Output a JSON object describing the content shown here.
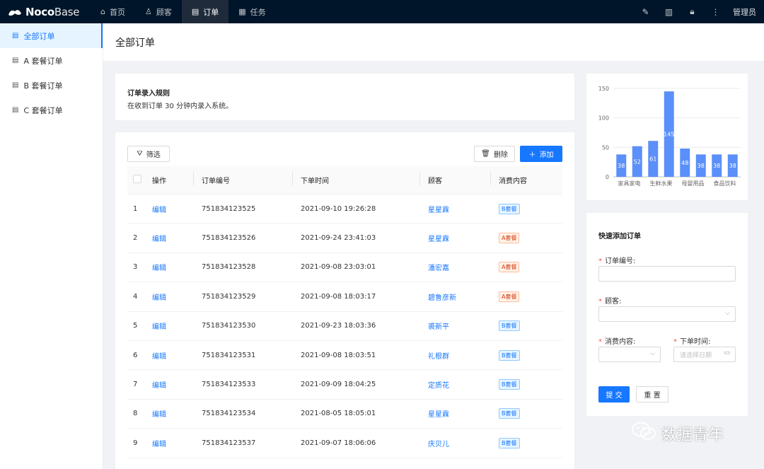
{
  "app": {
    "logo_bold": "Noco",
    "logo_thin": "Base"
  },
  "nav": {
    "items": [
      {
        "label": "首页",
        "icon": "home-icon"
      },
      {
        "label": "顾客",
        "icon": "users-icon"
      },
      {
        "label": "订单",
        "icon": "file-icon"
      },
      {
        "label": "任务",
        "icon": "task-icon"
      }
    ],
    "active": "订单",
    "user": "管理员"
  },
  "sidebar": {
    "items": [
      {
        "label": "全部订单"
      },
      {
        "label": "A 套餐订单"
      },
      {
        "label": "B 套餐订单"
      },
      {
        "label": "C 套餐订单"
      }
    ]
  },
  "page": {
    "title": "全部订单"
  },
  "rule": {
    "title": "订单录入规则",
    "text": "在收到订单 30 分钟内录入系统。"
  },
  "toolbar": {
    "filter_label": "筛选",
    "delete_label": "删除",
    "add_label": "添加"
  },
  "table": {
    "columns": [
      "操作",
      "订单编号",
      "下单时间",
      "顾客",
      "消费内容"
    ],
    "rows": [
      {
        "no": "1",
        "action": "编辑",
        "order_id": "751834123525",
        "time": "2021-09-10 19:26:28",
        "customer": "星星霖",
        "tag": "B套餐"
      },
      {
        "no": "2",
        "action": "编辑",
        "order_id": "751834123526",
        "time": "2021-09-24 23:41:03",
        "customer": "星星霖",
        "tag": "A套餐"
      },
      {
        "no": "3",
        "action": "编辑",
        "order_id": "751834123528",
        "time": "2021-09-08 23:03:01",
        "customer": "潘宏嘉",
        "tag": "A套餐"
      },
      {
        "no": "4",
        "action": "编辑",
        "order_id": "751834123529",
        "time": "2021-09-08 18:03:17",
        "customer": "碧鲁彦新",
        "tag": "A套餐"
      },
      {
        "no": "5",
        "action": "编辑",
        "order_id": "751834123530",
        "time": "2021-09-23 18:03:36",
        "customer": "裘新平",
        "tag": "B套餐"
      },
      {
        "no": "6",
        "action": "编辑",
        "order_id": "751834123531",
        "time": "2021-09-08 18:03:51",
        "customer": "礼根群",
        "tag": "B套餐"
      },
      {
        "no": "7",
        "action": "编辑",
        "order_id": "751834123533",
        "time": "2021-09-09 18:04:25",
        "customer": "定质花",
        "tag": "B套餐"
      },
      {
        "no": "8",
        "action": "编辑",
        "order_id": "751834123534",
        "time": "2021-08-05 18:05:01",
        "customer": "星星霖",
        "tag": "B套餐"
      },
      {
        "no": "9",
        "action": "编辑",
        "order_id": "751834123537",
        "time": "2021-09-07 18:06:06",
        "customer": "庆贝儿",
        "tag": "B套餐"
      }
    ]
  },
  "chart_data": {
    "type": "bar",
    "categories": [
      "家具家电",
      "",
      "生鲜水果",
      "",
      "母婴用品",
      "",
      "食品饮料",
      ""
    ],
    "values": [
      38,
      52,
      61,
      145,
      48,
      38,
      38,
      38
    ],
    "ylim": [
      0,
      150
    ],
    "yticks": [
      0,
      50,
      100,
      150
    ],
    "grid": true,
    "color": "#5b8ff9"
  },
  "form": {
    "title": "快速添加订单",
    "order_id_label": "订单编号:",
    "customer_label": "顾客:",
    "content_label": "消费内容:",
    "time_label": "下单时间:",
    "date_placeholder": "请选择日期",
    "submit_label": "提 交",
    "reset_label": "重 置"
  },
  "watermark": {
    "text": "数据青年"
  },
  "colors": {
    "primary": "#1677ff",
    "topbar": "#001529",
    "danger": "#ff4d4f"
  }
}
